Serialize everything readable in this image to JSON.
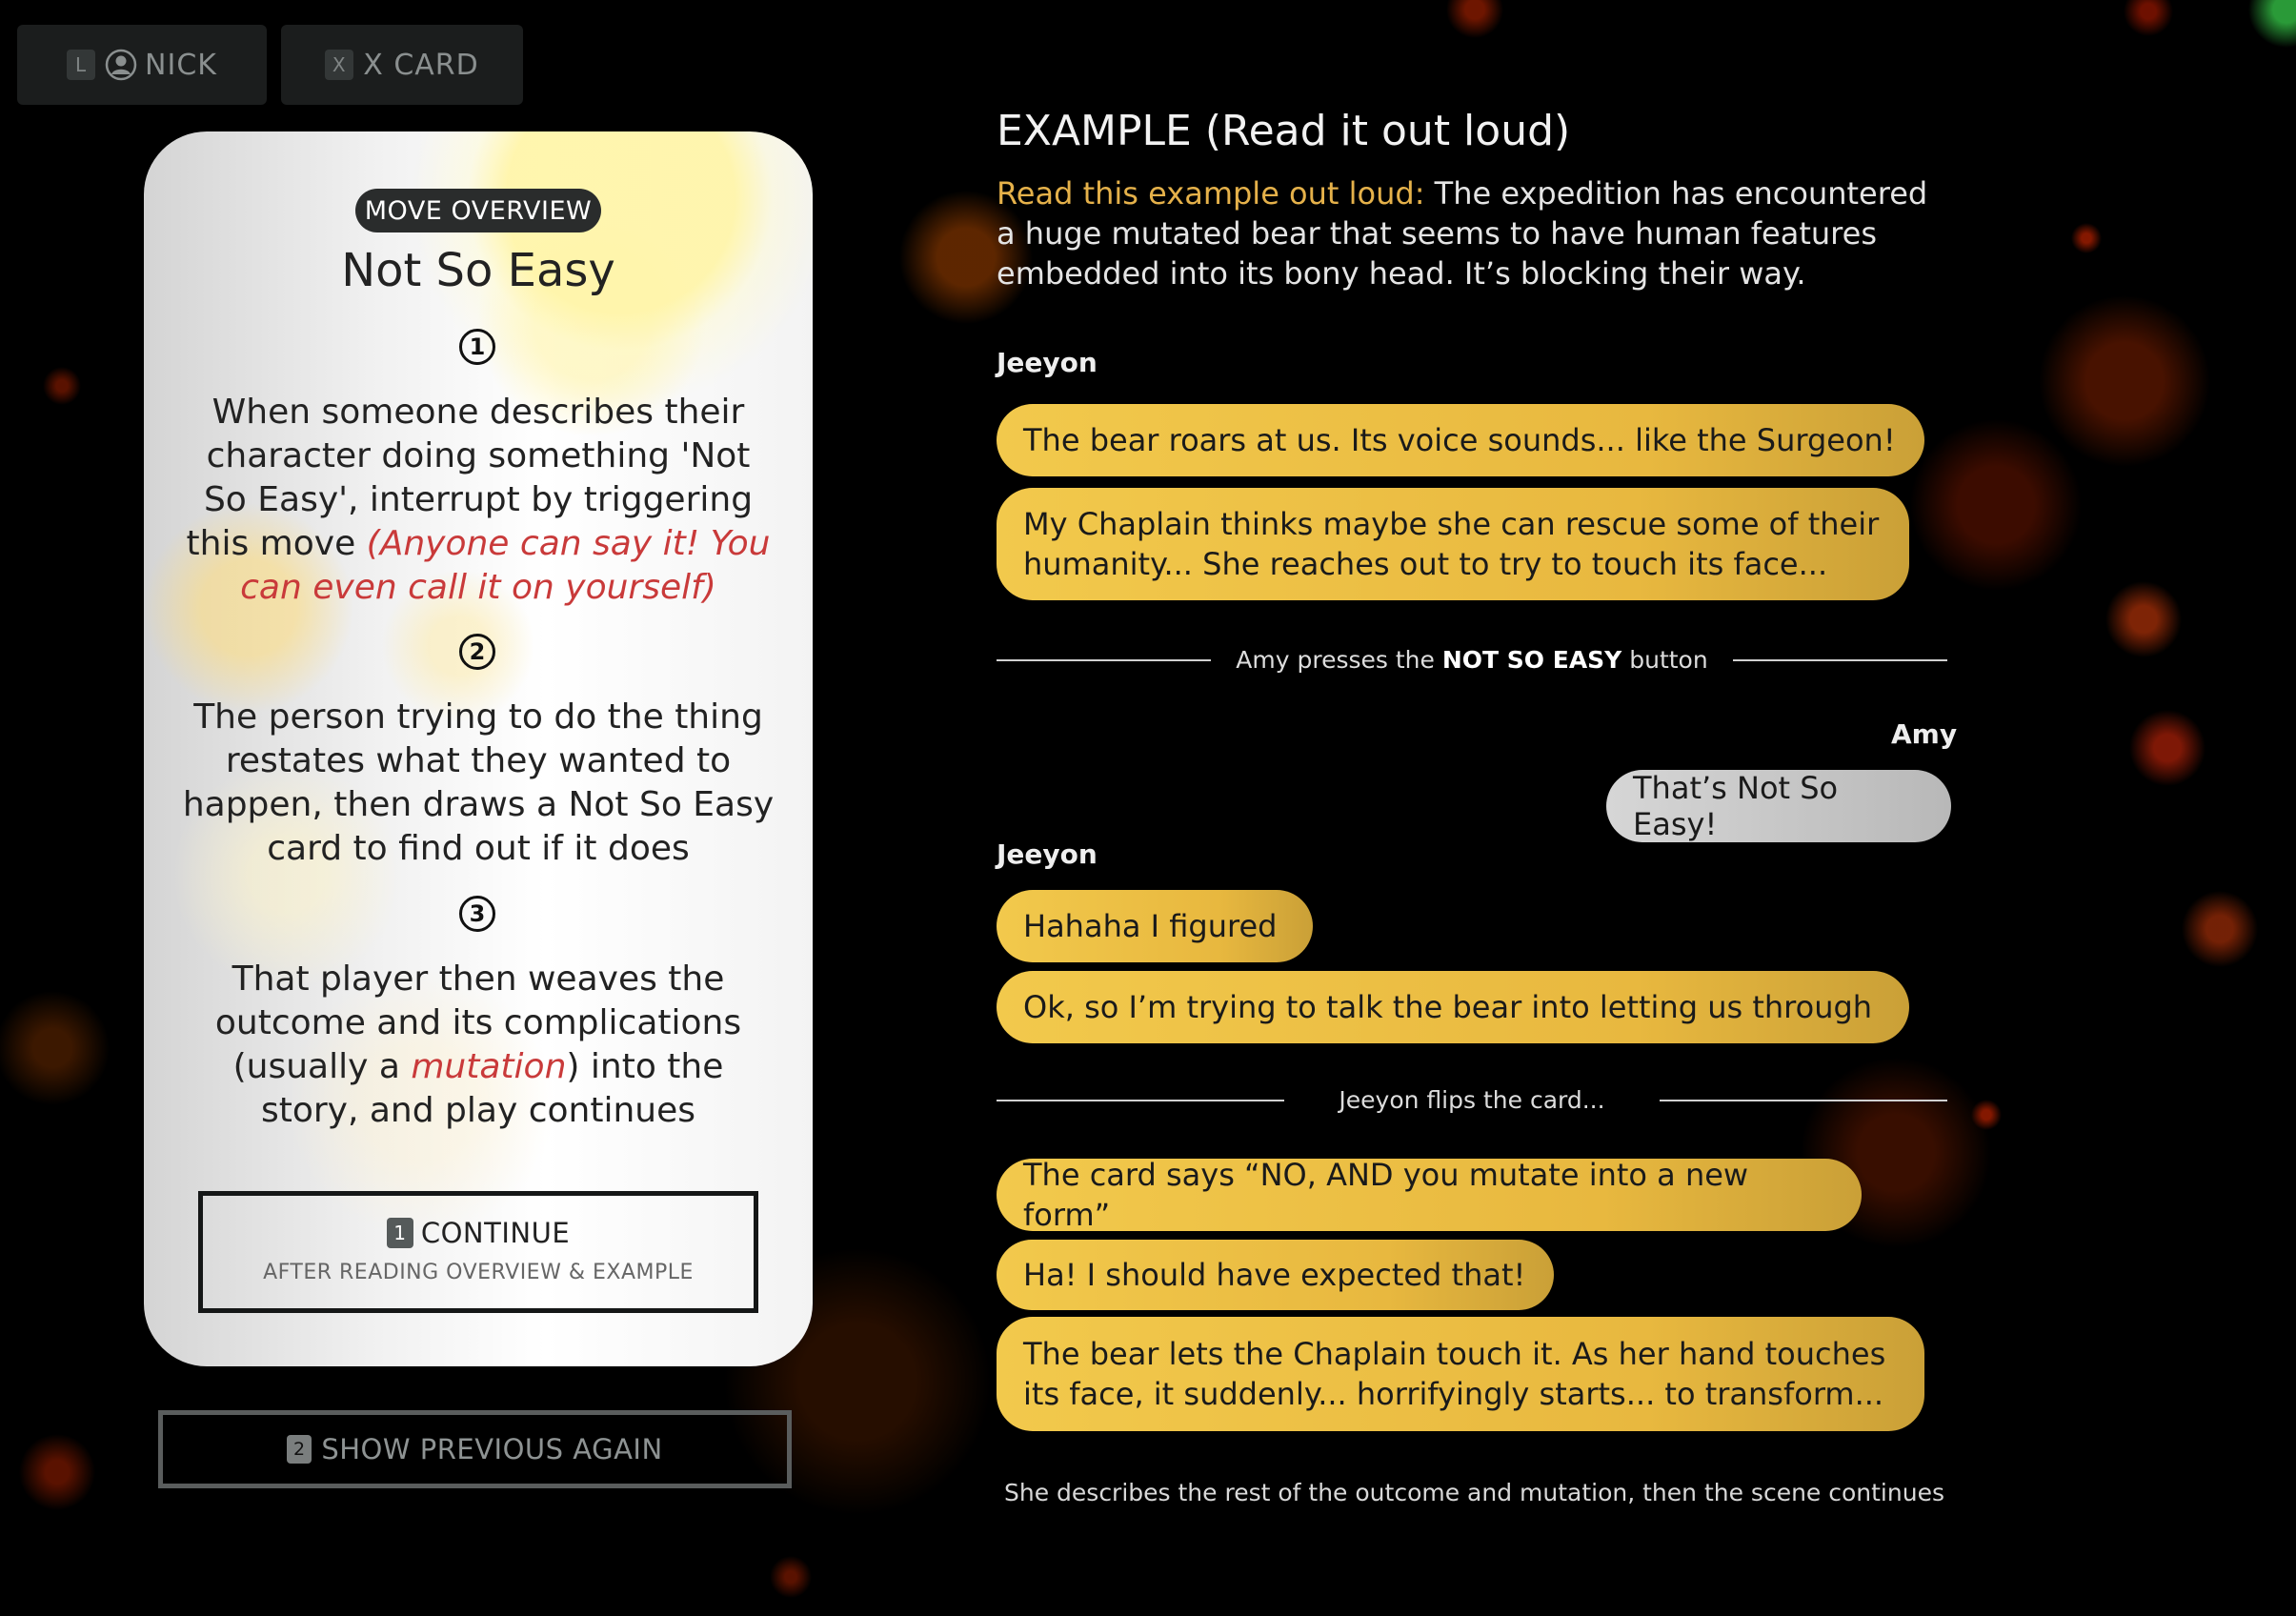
{
  "top_bar": {
    "nick": {
      "key": "L",
      "label": "NICK"
    },
    "xcard": {
      "key": "X",
      "label": "X CARD"
    }
  },
  "card": {
    "badge": "MOVE OVERVIEW",
    "title": "Not So Easy",
    "steps": [
      {
        "num": "1",
        "text": "When someone describes their character doing something 'Not So Easy', interrupt by triggering this move ",
        "aside": "(Anyone can say it! You can even call it on yourself)"
      },
      {
        "num": "2",
        "text": "The person trying to do the thing restates what they wanted to happen, then draws a Not So Easy card to find out if it does"
      },
      {
        "num": "3",
        "text_before": "That player then weaves the outcome and its complications (usually a ",
        "highlight": "mutation",
        "text_after": ") into the story, and play continues"
      }
    ],
    "continue": {
      "key": "1",
      "label": "CONTINUE",
      "sub": "AFTER READING OVERVIEW & EXAMPLE"
    }
  },
  "show_previous": {
    "key": "2",
    "label": "SHOW PREVIOUS AGAIN"
  },
  "example": {
    "title": "EXAMPLE (Read it out loud)",
    "intro_lead": "Read this example out loud:",
    "intro_text": " The expedition has encountered a huge mutated bear that seems to have human features embedded into its bony head. It’s blocking their way.",
    "speaker_1": "Jeeyon",
    "msg_1": "The bear roars at us. Its voice sounds... like the Surgeon!",
    "msg_2": "My Chaplain thinks maybe she can rescue some of their humanity... She reaches out to try to touch its face...",
    "divider_1_pre": "Amy presses the ",
    "divider_1_bold": "NOT SO EASY",
    "divider_1_post": " button",
    "speaker_2": "Amy",
    "msg_3": "That’s Not So Easy!",
    "speaker_3": "Jeeyon",
    "msg_4": "Hahaha I figured",
    "msg_5": "Ok, so I’m trying to talk the bear into letting us through",
    "divider_2": "Jeeyon flips the card...",
    "msg_6": "The card says “NO, AND you mutate into a new form”",
    "msg_7": "Ha! I should have expected that!",
    "msg_8": "The bear lets the Chaplain touch it. As her hand touches its face, it suddenly... horrifyingly starts... to transform...",
    "footer": "She describes the rest of the outcome and mutation, then the scene continues"
  }
}
